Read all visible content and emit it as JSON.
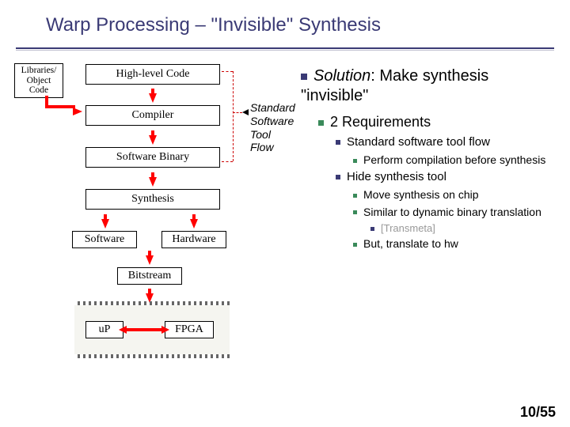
{
  "title": "Warp Processing – \"Invisible\" Synthesis",
  "diagram": {
    "libs": "Libraries/ Object Code",
    "hlc": "High-level Code",
    "compiler": "Compiler",
    "swbin": "Software Binary",
    "synthesis": "Synthesis",
    "software": "Software",
    "hardware": "Hardware",
    "bitstream": "Bitstream",
    "annot_l1": "Standard",
    "annot_l2": "Software",
    "annot_l3": "Tool Flow",
    "up": "uP",
    "fpga": "FPGA"
  },
  "bullets": {
    "l1_pre": "Solution",
    "l1_post": ": Make synthesis \"invisible\"",
    "l2": "2 Requirements",
    "l3a": "Standard software tool flow",
    "l4a": "Perform compilation before synthesis",
    "l3b": "Hide synthesis tool",
    "l4b": "Move synthesis on chip",
    "l4c": "Similar to dynamic binary translation",
    "l5a": "[Transmeta]",
    "l4d": "But, translate to hw"
  },
  "footer": "10/55"
}
